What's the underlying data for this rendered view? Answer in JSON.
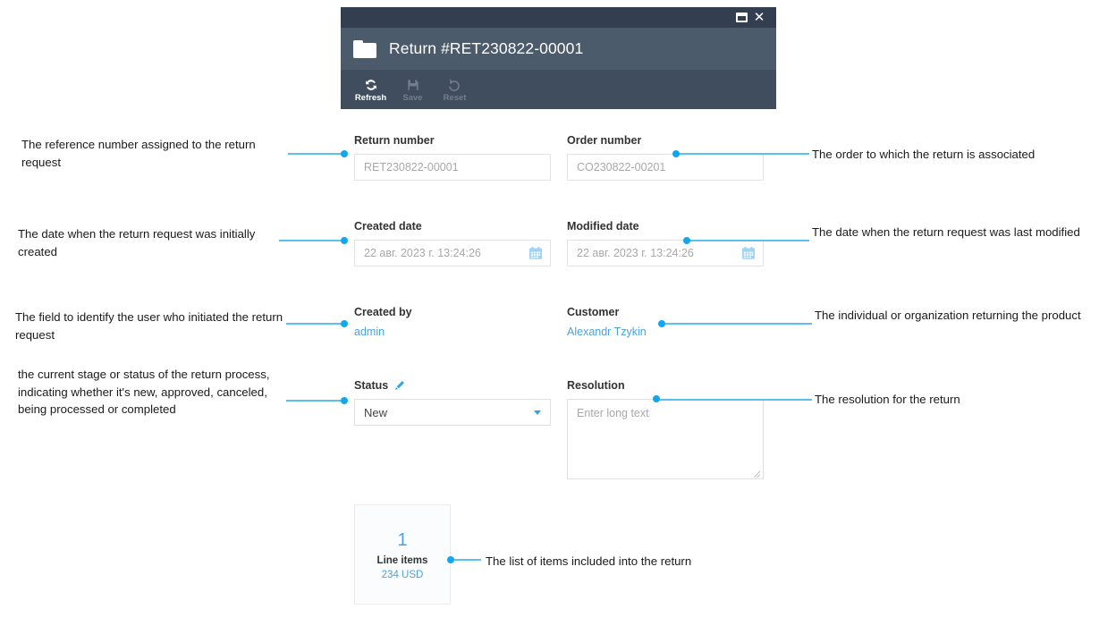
{
  "window": {
    "title": "Return #RET230822-00001",
    "folder_icon": "folder-icon",
    "restore_label": "restore-window",
    "close_label": "close-window",
    "toolbar": [
      {
        "label": "Refresh",
        "icon": "refresh-icon",
        "enabled": true
      },
      {
        "label": "Save",
        "icon": "save-icon",
        "enabled": false
      },
      {
        "label": "Reset",
        "icon": "reset-icon",
        "enabled": false
      }
    ]
  },
  "form": {
    "return_number": {
      "label": "Return number",
      "value": "RET230822-00001"
    },
    "order_number": {
      "label": "Order number",
      "value": "CO230822-00201"
    },
    "created_date": {
      "label": "Created date",
      "value": "22 авг. 2023 г. 13:24:26",
      "icon": "calendar-icon"
    },
    "modified_date": {
      "label": "Modified date",
      "value": "22 авг. 2023 г. 13:24:26",
      "icon": "calendar-icon"
    },
    "created_by": {
      "label": "Created by",
      "value": "admin"
    },
    "customer": {
      "label": "Customer",
      "value": "Alexandr Tzykin"
    },
    "status": {
      "label": "Status",
      "edit_icon": "pencil-icon",
      "value": "New"
    },
    "resolution": {
      "label": "Resolution",
      "placeholder": "Enter long text",
      "value": ""
    }
  },
  "line_items_card": {
    "count": "1",
    "title": "Line items",
    "amount": "234 USD"
  },
  "annotations": {
    "return_number": "The reference number assigned to the return request",
    "order_number": "The order to which the return is associated",
    "created_date": "The date when the return request was initially created",
    "modified_date": "The date when the return request was last modified",
    "created_by": "The field to identify the user who initiated the return request",
    "customer": "The individual or organization returning the product",
    "status": "the current stage or status of the return process, indicating whether it's new, approved, canceled, being processed or completed",
    "resolution": "The resolution for the return",
    "line_items": "The list of items included into the return"
  },
  "colors": {
    "window_topbar": "#333f50",
    "window_titlebar": "#4c5b6c",
    "window_toolbar": "#404d5e",
    "accent_blue": "#4aa3e0",
    "connector_blue": "#5bc0f0",
    "dot_blue": "#11a7ef"
  }
}
